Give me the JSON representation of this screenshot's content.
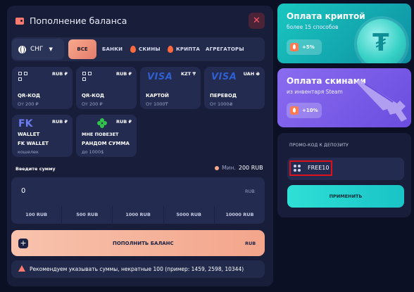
{
  "dialog": {
    "title": "Пополнение баланса",
    "close_icon": "close-icon"
  },
  "filters": {
    "region": "СНГ",
    "tabs": [
      {
        "label": "ВСЕ",
        "active": true
      },
      {
        "label": "БАНКИ"
      },
      {
        "label": "СКИНЫ",
        "icon": "fire-icon"
      },
      {
        "label": "КРИПТА",
        "icon": "fire-icon"
      },
      {
        "label": "АГРЕГАТОРЫ"
      }
    ]
  },
  "methods": [
    {
      "icon": "qr-icon",
      "currency": "RUB ₽",
      "name": "QR-КОД",
      "min": "От 200 ₽"
    },
    {
      "icon": "qr-icon",
      "currency": "RUB ₽",
      "name": "QR-КОД",
      "min": "От 200 ₽"
    },
    {
      "icon": "visa-logo",
      "logo_text": "VISA",
      "currency": "KZT ₸",
      "name": "КАРТОЙ",
      "min": "От 1000₸"
    },
    {
      "icon": "visa-logo",
      "logo_text": "VISA",
      "currency": "UAH ₴",
      "name": "ПЕРЕВОД",
      "min": "От 1000₴"
    },
    {
      "icon": "fk-logo",
      "logo_text": "FK",
      "currency": "RUB ₽",
      "name_top": "WALLET",
      "name": "FK WALLET",
      "min": "кошелек"
    },
    {
      "icon": "clover-icon",
      "currency": "RUB ₽",
      "name_top": "МНЕ ПОВЕЗЕТ",
      "name": "РАНДОМ СУММА",
      "min": "до 1000$"
    }
  ],
  "amount": {
    "label": "Введите сумму",
    "min_prefix": "Мин.",
    "min_value": "200 RUB",
    "value": "0",
    "currency": "RUB",
    "presets": [
      "100 RUB",
      "500 RUB",
      "1000 RUB",
      "5000 RUB",
      "10000 RUB"
    ]
  },
  "pay_button": {
    "label": "ПОПОЛНИТЬ БАЛАНС",
    "currency": "RUB"
  },
  "notice": "Рекомендуем указывать суммы, некратные 100 (пример: 1459, 2598, 10344)",
  "promo_crypto": {
    "title": "Оплата криптой",
    "subtitle": "более 15 способов",
    "bonus": "+5%"
  },
  "promo_skins": {
    "title": "Оплата скинами",
    "subtitle": "из инвентаря Steam",
    "bonus": "+10%"
  },
  "promo_code": {
    "label": "ПРОМО-КОД К ДЕПОЗИТУ",
    "value": "FREE10",
    "apply": "ПРИМЕНИТЬ"
  },
  "colors": {
    "accent": "#f3a58b",
    "crypto": "#19c7c0",
    "skins": "#7a5cea",
    "highlight": "#e0101a"
  }
}
